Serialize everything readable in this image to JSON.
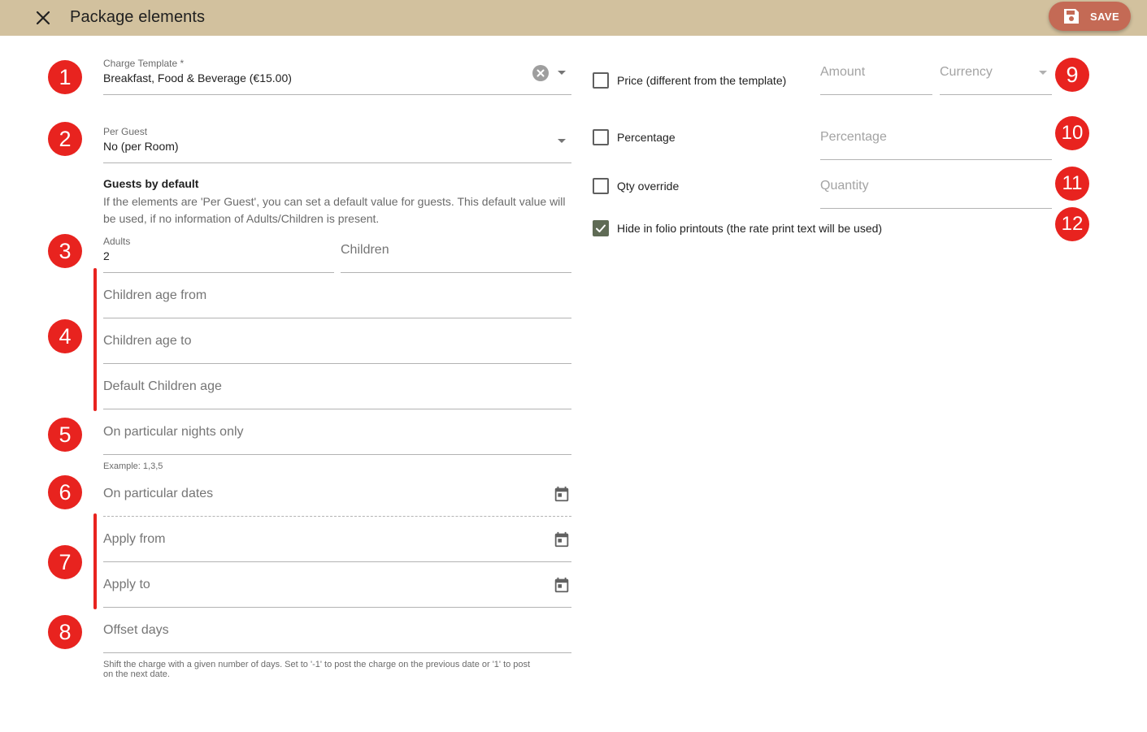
{
  "header": {
    "title": "Package elements",
    "save_label": "SAVE"
  },
  "badges": [
    "1",
    "2",
    "3",
    "4",
    "5",
    "6",
    "7",
    "8",
    "9",
    "10",
    "11",
    "12"
  ],
  "left": {
    "charge_template": {
      "label": "Charge Template *",
      "value": "Breakfast, Food & Beverage (€15.00)"
    },
    "per_guest": {
      "label": "Per Guest",
      "value": "No (per Room)"
    },
    "guests_default": {
      "heading": "Guests by default",
      "help_line1": "If the elements are 'Per Guest', you can set a default value for guests. This default value will",
      "help_line2": "be used, if no information of Adults/Children is present."
    },
    "adults": {
      "label": "Adults",
      "value": "2"
    },
    "children": {
      "placeholder": "Children"
    },
    "children_age_from": {
      "placeholder": "Children age from"
    },
    "children_age_to": {
      "placeholder": "Children age to"
    },
    "default_children_age": {
      "placeholder": "Default Children age"
    },
    "particular_nights": {
      "placeholder": "On particular nights only",
      "hint": "Example: 1,3,5"
    },
    "particular_dates": {
      "placeholder": "On particular dates"
    },
    "apply_from": {
      "placeholder": "Apply from"
    },
    "apply_to": {
      "placeholder": "Apply to"
    },
    "offset_days": {
      "placeholder": "Offset days",
      "hint_line1": "Shift the charge with a given number of days. Set to '-1' to post the charge on the previous date or '1' to post",
      "hint_line2": "on the next date."
    }
  },
  "right": {
    "price": {
      "label": "Price (different from the template)",
      "checked": false,
      "amount_placeholder": "Amount",
      "currency_placeholder": "Currency"
    },
    "percentage": {
      "label": "Percentage",
      "checked": false,
      "placeholder": "Percentage"
    },
    "qty_override": {
      "label": "Qty override",
      "checked": false,
      "placeholder": "Quantity"
    },
    "hide_folio": {
      "label": "Hide in folio printouts (the rate print text will be used)",
      "checked": true
    }
  },
  "colors": {
    "header_bg": "#d2c19e",
    "save_button": "#c46a55",
    "badge": "#e8231f",
    "checkbox_checked": "#5f6b55"
  },
  "icons": [
    "close-icon",
    "floppy-disk-icon",
    "clear-circle-icon",
    "dropdown-arrow-icon",
    "calendar-icon",
    "check-icon"
  ]
}
